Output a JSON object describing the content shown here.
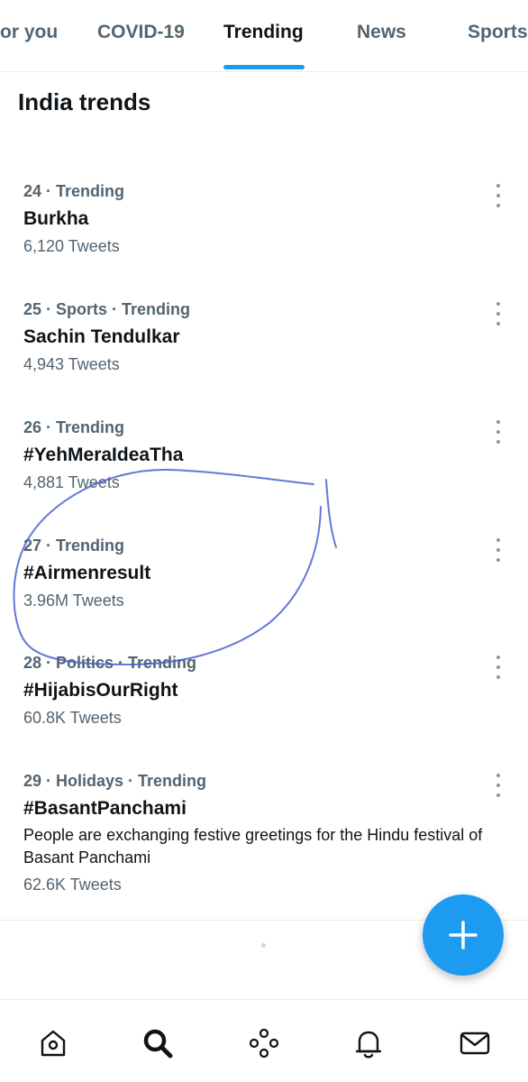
{
  "tabs": [
    {
      "label": "or you"
    },
    {
      "label": "COVID-19"
    },
    {
      "label": "Trending"
    },
    {
      "label": "News"
    },
    {
      "label": "Sports"
    }
  ],
  "section_title": "India trends",
  "trends": [
    {
      "meta": "24 · Trending",
      "name": "Burkha",
      "count": "6,120 Tweets"
    },
    {
      "meta": "25 · Sports · Trending",
      "name": "Sachin Tendulkar",
      "count": "4,943 Tweets"
    },
    {
      "meta": "26 · Trending",
      "name": "#YehMeraIdeaTha",
      "count": "4,881 Tweets"
    },
    {
      "meta": "27 · Trending",
      "name": "#Airmenresult",
      "count": "3.96M Tweets"
    },
    {
      "meta": "28 · Politics · Trending",
      "name": "#HijabisOurRight",
      "count": "60.8K Tweets"
    },
    {
      "meta": "29 · Holidays · Trending",
      "name": "#BasantPanchami",
      "description": "People are exchanging festive greetings for the Hindu festival of Basant Panchami",
      "count": "62.6K Tweets"
    }
  ],
  "icons": {
    "fab": "plus-icon",
    "nav": [
      "home-icon",
      "search-icon",
      "spaces-icon",
      "bell-icon",
      "mail-icon"
    ],
    "trend_menu": "more-vertical-icon"
  },
  "colors": {
    "accent": "#1d9bf0",
    "text_primary": "#0f1419",
    "text_secondary": "#536471",
    "annotation": "#4a5fd0"
  }
}
